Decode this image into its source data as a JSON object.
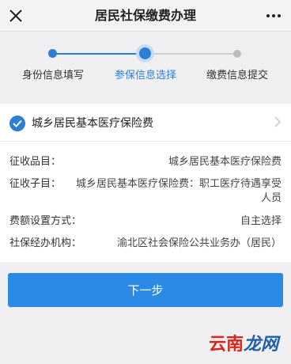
{
  "header": {
    "title": "居民社保缴费办理",
    "close_icon": "close-icon",
    "more_icon": "more-icon"
  },
  "steps": {
    "items": [
      {
        "label": "身份信息填写",
        "state": "done"
      },
      {
        "label": "参保信息选择",
        "state": "current"
      },
      {
        "label": "缴费信息提交",
        "state": "pending"
      }
    ]
  },
  "selection": {
    "label": "城乡居民基本医疗保险费",
    "checked": true
  },
  "details": {
    "collection_item": {
      "label": "征收品目：",
      "value": "城乡居民基本医疗保险费"
    },
    "collection_subitem": {
      "label": "征收子目：",
      "value_line1": "城乡居民基本医疗保险费：职工医疗待遇享受",
      "value_line2": "人员"
    },
    "amount_setting": {
      "label": "费额设置方式：",
      "value": "自主选择"
    },
    "agency": {
      "label": "社保经办机构：",
      "value": "渝北区社会保险公共业务办（居民）"
    }
  },
  "actions": {
    "next_label": "下一步"
  },
  "watermark": {
    "part1": "云南",
    "part2": "龙网"
  },
  "colors": {
    "accent": "#2a8ae4",
    "step_done": "#2c7fd4",
    "step_pending": "#bdbdbd",
    "watermark_red": "#d9261c",
    "watermark_blue": "#1f5ea8"
  }
}
